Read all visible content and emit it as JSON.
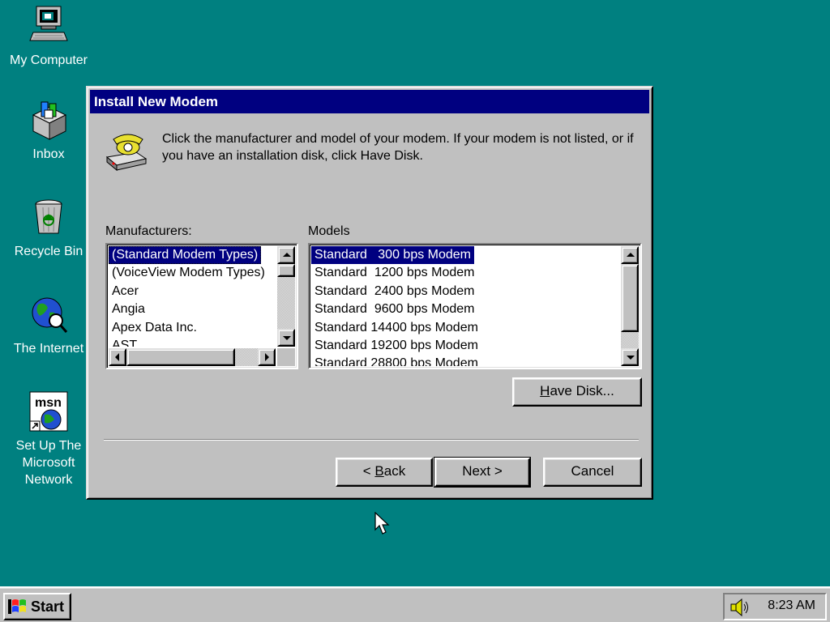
{
  "desktop": {
    "background": "#008080",
    "icons": [
      {
        "label": "My Computer",
        "icon": "computer-icon"
      },
      {
        "label": "Inbox",
        "icon": "inbox-icon"
      },
      {
        "label": "Recycle Bin",
        "icon": "recycle-bin-icon"
      },
      {
        "label": "The Internet",
        "icon": "internet-globe-icon"
      },
      {
        "label": "Set Up The\nMicrosoft\nNetwork",
        "icon": "msn-icon"
      }
    ]
  },
  "dialog": {
    "title": "Install New Modem",
    "instructions": "Click the manufacturer and model of your modem. If your modem is not listed, or if you have an installation disk, click Have Disk.",
    "manufacturers_label": "Manufacturers:",
    "models_label": "Models",
    "manufacturers": [
      "(Standard Modem Types)",
      "(VoiceView Modem Types)",
      "Acer",
      "Angia",
      "Apex Data Inc.",
      "AST"
    ],
    "manufacturers_selected": "(Standard Modem Types)",
    "models": [
      "Standard   300 bps Modem",
      "Standard  1200 bps Modem",
      "Standard  2400 bps Modem",
      "Standard  9600 bps Modem",
      "Standard 14400 bps Modem",
      "Standard 19200 bps Modem",
      "Standard 28800 bps Modem"
    ],
    "models_selected": "Standard   300 bps Modem",
    "have_disk_button": {
      "pre": "",
      "key": "H",
      "post": "ave Disk..."
    },
    "back_button": {
      "pre": "< ",
      "key": "B",
      "post": "ack"
    },
    "next_button": "Next >",
    "cancel_button": "Cancel",
    "colors": {
      "face": "#c0c0c0",
      "titlebar": "#000080",
      "selection": "#000080"
    }
  },
  "taskbar": {
    "start_label": "Start",
    "clock": "8:23 AM",
    "tray_icons": [
      "speaker-icon"
    ]
  }
}
